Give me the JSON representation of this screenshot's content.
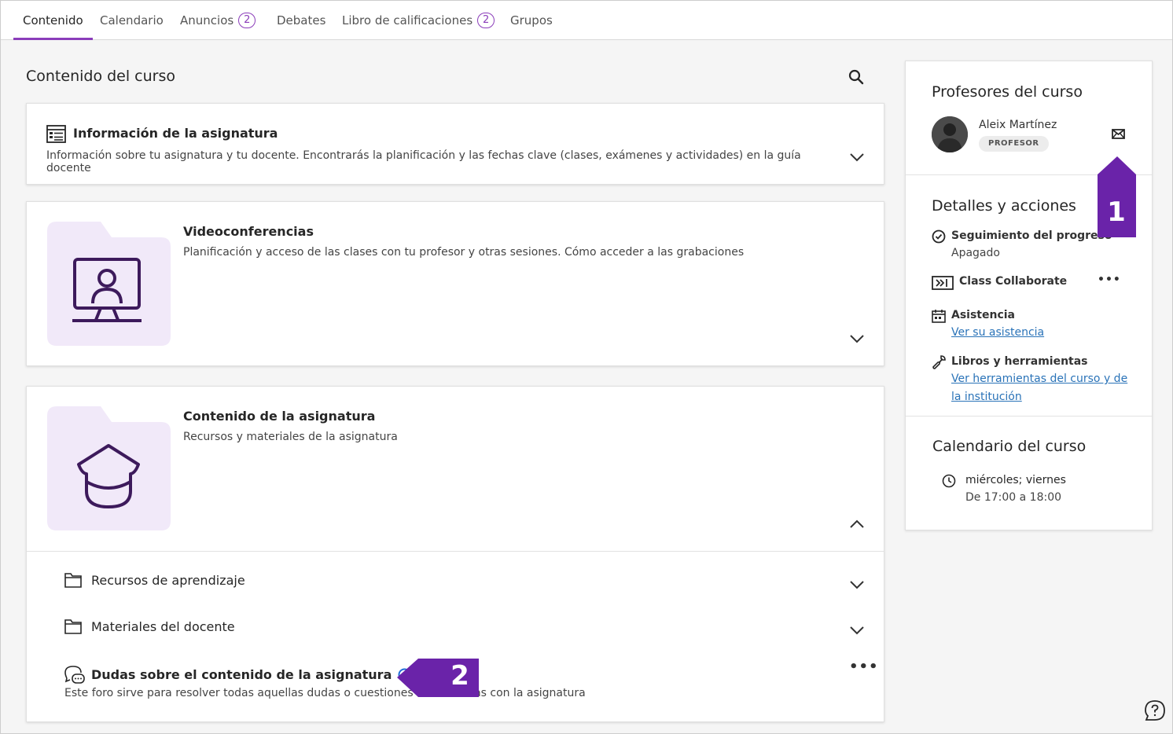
{
  "nav": {
    "tabs": [
      {
        "label": "Contenido",
        "active": true
      },
      {
        "label": "Calendario"
      },
      {
        "label": "Anuncios",
        "badge": "2"
      },
      {
        "label": "Debates"
      },
      {
        "label": "Libro de calificaciones",
        "badge": "2"
      },
      {
        "label": "Grupos"
      }
    ]
  },
  "main": {
    "title": "Contenido del curso",
    "info_card": {
      "title": "Información de la asignatura",
      "desc": "Información sobre tu asignatura y tu docente. Encontrarás la planificación y las fechas clave (clases, exámenes y actividades) en la guía docente"
    },
    "video_card": {
      "title": "Videoconferencias",
      "desc": "Planificación y acceso de las clases con tu profesor y otras sesiones. Cómo acceder a las grabaciones"
    },
    "content_card": {
      "title": "Contenido de la asignatura",
      "desc": "Recursos y materiales de la asignatura",
      "items": [
        {
          "label": "Recursos de aprendizaje"
        },
        {
          "label": "Materiales del docente"
        }
      ],
      "forum": {
        "title": "Dudas sobre el contenido de la asignatura",
        "desc": "Este foro sirve para resolver todas aquellas dudas o cuestiones relacionadas con la asignatura"
      }
    }
  },
  "panel": {
    "teachers_title": "Profesores del curso",
    "teacher_name": "Aleix Martínez",
    "teacher_role": "PROFESOR",
    "details_title": "Detalles y acciones",
    "progress_label": "Seguimiento del progreso",
    "progress_value": "Apagado",
    "collaborate_label": "Class Collaborate",
    "attendance_label": "Asistencia",
    "attendance_link": "Ver su asistencia",
    "tools_label": "Libros y herramientas",
    "tools_link_1": "Ver herramientas del curso y de",
    "tools_link_2": "la institución",
    "calendar_title": "Calendario del curso",
    "schedule_days": "miércoles; viernes",
    "schedule_time": "De 17:00 a 18:00"
  },
  "callouts": {
    "one": "1",
    "two": "2"
  },
  "colors": {
    "accent": "#8b3dba",
    "callout": "#6a23a9",
    "thumb_bg": "#f1e9f9",
    "icon_dark": "#3d1a5c",
    "link": "#2a73b8"
  }
}
